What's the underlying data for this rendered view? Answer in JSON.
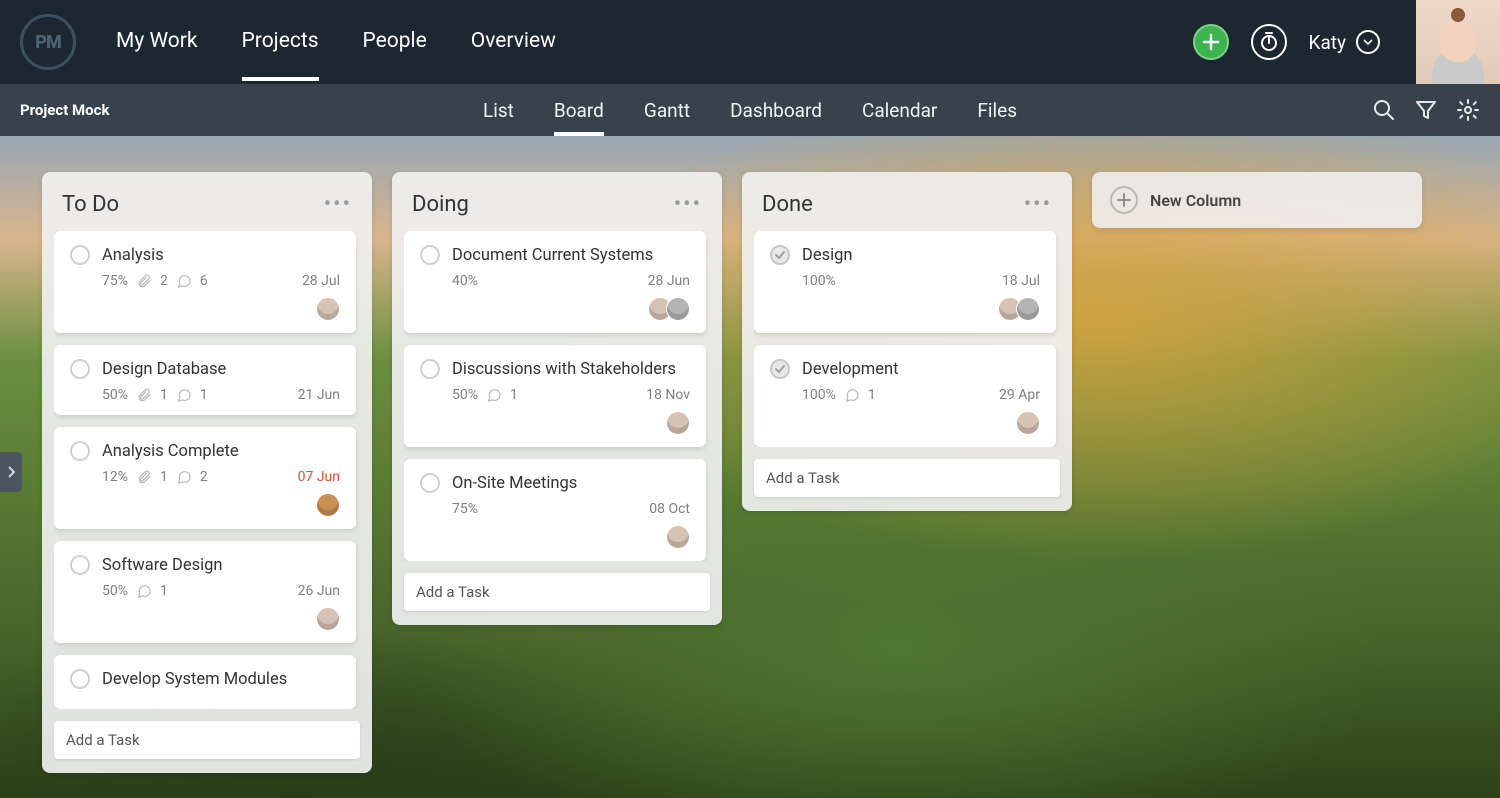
{
  "app": {
    "logo_text": "PM"
  },
  "nav": {
    "items": [
      "My Work",
      "Projects",
      "People",
      "Overview"
    ],
    "active_index": 1
  },
  "header_actions": {
    "user_name": "Katy"
  },
  "project": {
    "name": "Project Mock"
  },
  "views": {
    "items": [
      "List",
      "Board",
      "Gantt",
      "Dashboard",
      "Calendar",
      "Files"
    ],
    "active_index": 1
  },
  "board": {
    "new_column_label": "New Column",
    "add_task_label": "Add a Task",
    "columns": [
      {
        "title": "To Do",
        "cards": [
          {
            "title": "Analysis",
            "percent": "75%",
            "attachments": "2",
            "comments": "6",
            "date": "28 Jul",
            "overdue": false,
            "avatars": 1,
            "done": false
          },
          {
            "title": "Design Database",
            "percent": "50%",
            "attachments": "1",
            "comments": "1",
            "date": "21 Jun",
            "overdue": false,
            "avatars": 0,
            "done": false
          },
          {
            "title": "Analysis Complete",
            "percent": "12%",
            "attachments": "1",
            "comments": "2",
            "date": "07 Jun",
            "overdue": true,
            "avatars": 1,
            "done": false
          },
          {
            "title": "Software Design",
            "percent": "50%",
            "attachments": null,
            "comments": "1",
            "date": "26 Jun",
            "overdue": false,
            "avatars": 1,
            "done": false
          },
          {
            "title": "Develop System Modules",
            "percent": null,
            "attachments": null,
            "comments": null,
            "date": null,
            "overdue": false,
            "avatars": 0,
            "done": false
          }
        ]
      },
      {
        "title": "Doing",
        "cards": [
          {
            "title": "Document Current Systems",
            "percent": "40%",
            "attachments": null,
            "comments": null,
            "date": "28 Jun",
            "overdue": false,
            "avatars": 2,
            "done": false
          },
          {
            "title": "Discussions with Stakeholders",
            "percent": "50%",
            "attachments": null,
            "comments": "1",
            "date": "18 Nov",
            "overdue": false,
            "avatars": 1,
            "done": false
          },
          {
            "title": "On-Site Meetings",
            "percent": "75%",
            "attachments": null,
            "comments": null,
            "date": "08 Oct",
            "overdue": false,
            "avatars": 1,
            "done": false
          }
        ]
      },
      {
        "title": "Done",
        "cards": [
          {
            "title": "Design",
            "percent": "100%",
            "attachments": null,
            "comments": null,
            "date": "18 Jul",
            "overdue": false,
            "avatars": 2,
            "done": true
          },
          {
            "title": "Development",
            "percent": "100%",
            "attachments": null,
            "comments": "1",
            "date": "29 Apr",
            "overdue": false,
            "avatars": 1,
            "done": true
          }
        ]
      }
    ]
  }
}
